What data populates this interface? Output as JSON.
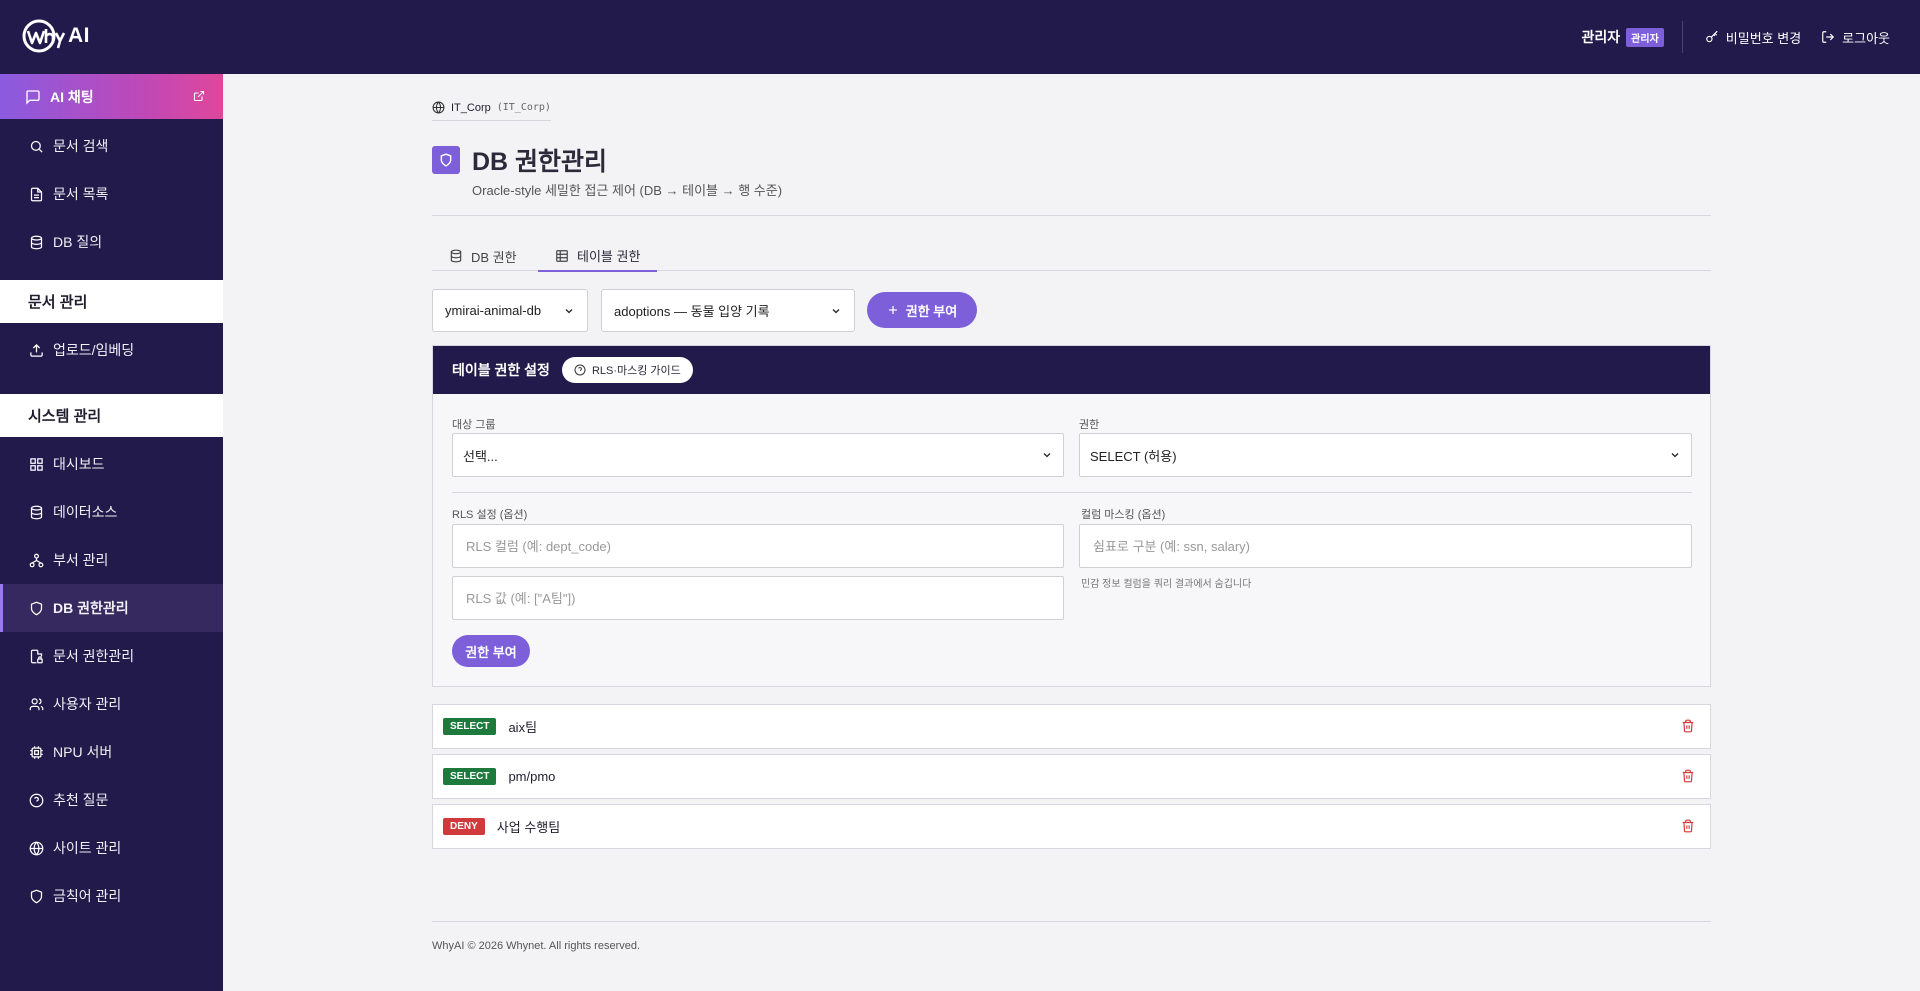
{
  "brand": {
    "name": "AI"
  },
  "topbar": {
    "user": "관리자",
    "role_badge": "관리자",
    "change_password": "비밀번호 변경",
    "logout": "로그아웃"
  },
  "sidebar": {
    "chat": "AI 채팅",
    "items_top": [
      {
        "label": "문서 검색",
        "icon": "search-icon"
      },
      {
        "label": "문서 목록",
        "icon": "document-icon"
      },
      {
        "label": "DB 질의",
        "icon": "database-icon"
      }
    ],
    "section_docs": "문서 관리",
    "items_docs": [
      {
        "label": "업로드/임베딩",
        "icon": "upload-icon"
      }
    ],
    "section_system": "시스템 관리",
    "items_system": [
      {
        "label": "대시보드",
        "icon": "dashboard-icon"
      },
      {
        "label": "데이터소스",
        "icon": "database-icon"
      },
      {
        "label": "부서 관리",
        "icon": "org-icon"
      },
      {
        "label": "DB 권한관리",
        "icon": "shield-icon",
        "active": true
      },
      {
        "label": "문서 권한관리",
        "icon": "doc-lock-icon"
      },
      {
        "label": "사용자 관리",
        "icon": "users-icon"
      },
      {
        "label": "NPU 서버",
        "icon": "chip-icon"
      },
      {
        "label": "추천 질문",
        "icon": "help-icon"
      },
      {
        "label": "사이트 관리",
        "icon": "globe-icon"
      },
      {
        "label": "금칙어 관리",
        "icon": "shield-icon"
      }
    ]
  },
  "page": {
    "tenant": "IT_Corp",
    "tenant_code": "(IT_Corp)",
    "title": "DB 권한관리",
    "subtitle": "Oracle-style 세밀한 접근 제어 (DB → 테이블 → 행 수준)",
    "tabs": [
      {
        "label": "DB 권한",
        "icon": "database-icon"
      },
      {
        "label": "테이블 권한",
        "icon": "table-icon",
        "active": true
      }
    ],
    "db_select": "ymirai-animal-db",
    "table_select": "adoptions — 동물 입양 기록",
    "grant_top_label": "권한 부여"
  },
  "panel": {
    "title": "테이블 권한 설정",
    "guide_label": "RLS·마스킹 가이드",
    "group_label": "대상 그룹",
    "group_value": "선택...",
    "perm_label": "권한",
    "perm_value": "SELECT (허용)",
    "rls_label": "RLS 설정 (옵션)",
    "rls_column_placeholder": "RLS 컬럼 (예: dept_code)",
    "rls_value_placeholder": "RLS 값 (예: [\"A팀\"])",
    "mask_label": "컬럼 마스킹 (옵션)",
    "mask_placeholder": "쉼표로 구분 (예: ssn, salary)",
    "mask_hint": "민감 정보 컬럼을 쿼리 결과에서 숨깁니다",
    "grant_label": "권한 부여"
  },
  "permissions": [
    {
      "badge": "SELECT",
      "group": "aix팀",
      "type": "select"
    },
    {
      "badge": "SELECT",
      "group": "pm/pmo",
      "type": "select"
    },
    {
      "badge": "DENY",
      "group": "사업 수행팀",
      "type": "deny"
    }
  ],
  "footer": "WhyAI © 2026 Whynet. All rights reserved.",
  "colors": {
    "navy": "#211a4a",
    "accent": "#7c5fd9",
    "select": "#1e7a3c",
    "deny": "#d03a3a"
  }
}
